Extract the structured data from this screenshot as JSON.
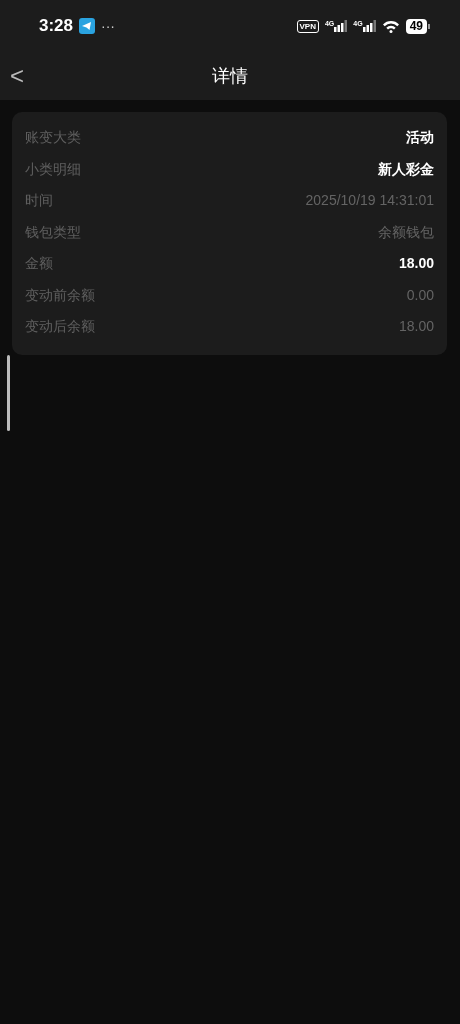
{
  "status_bar": {
    "time": "3:28",
    "more": "···",
    "vpn": "VPN",
    "networks": [
      "4G",
      "4G"
    ],
    "battery": "49"
  },
  "header": {
    "back": "<",
    "title": "详情"
  },
  "details": [
    {
      "label": "账变大类",
      "value": "活动",
      "emphasis": true
    },
    {
      "label": "小类明细",
      "value": "新人彩金",
      "emphasis": true
    },
    {
      "label": "时间",
      "value": "2025/10/19 14:31:01",
      "emphasis": false
    },
    {
      "label": "钱包类型",
      "value": "余额钱包",
      "emphasis": false
    },
    {
      "label": "金额",
      "value": "18.00",
      "emphasis": true
    },
    {
      "label": "变动前余额",
      "value": "0.00",
      "emphasis": false
    },
    {
      "label": "变动后余额",
      "value": "18.00",
      "emphasis": false
    }
  ]
}
